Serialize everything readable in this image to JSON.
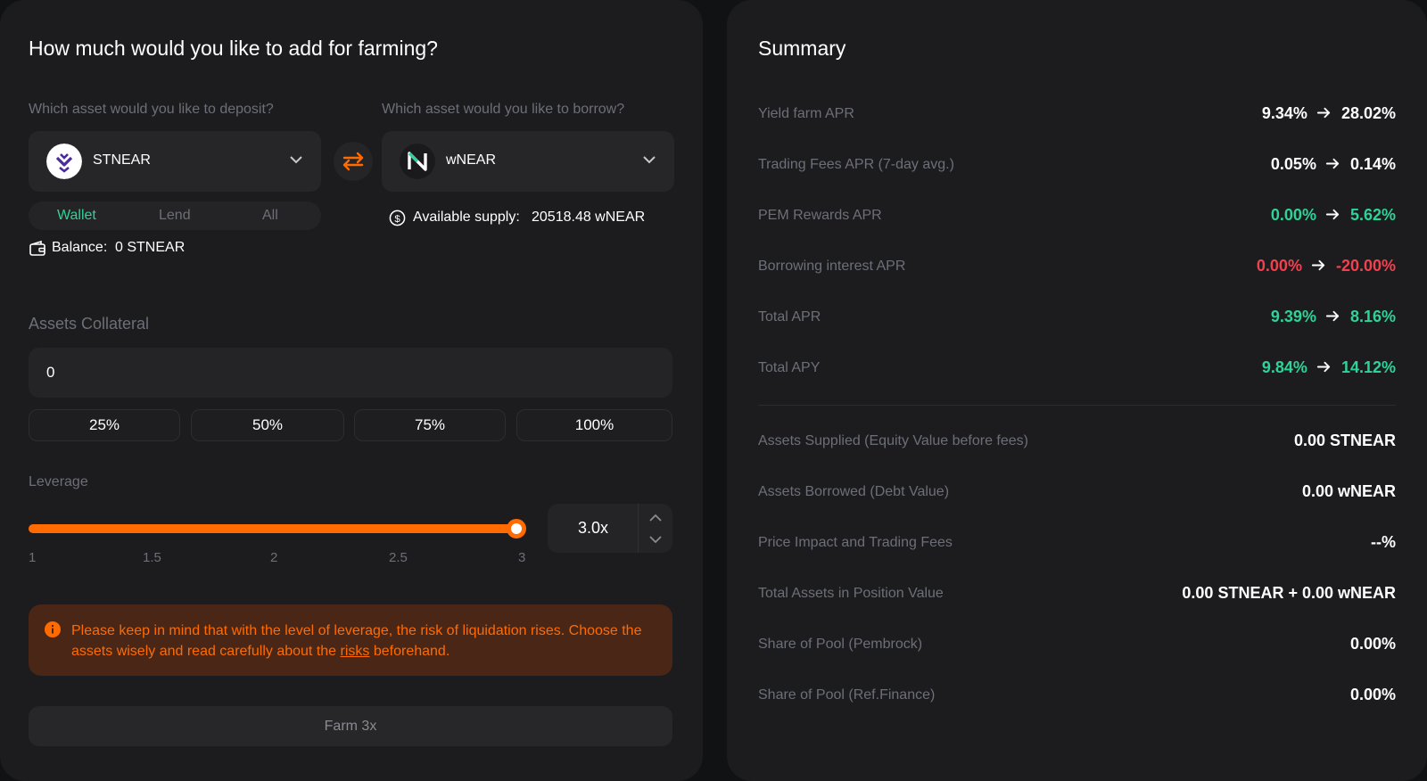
{
  "left": {
    "title": "How much would you like to add for farming?",
    "deposit_label": "Which asset would you like to deposit?",
    "borrow_label": "Which asset would you like to borrow?",
    "deposit_token": {
      "name": "STNEAR",
      "icon": "stnear-logo-icon"
    },
    "borrow_token": {
      "name": "wNEAR",
      "icon": "near-logo-icon"
    },
    "tabs": [
      "Wallet",
      "Lend",
      "All"
    ],
    "active_tab": "Wallet",
    "balance_label": "Balance:",
    "balance_value": "0 STNEAR",
    "supply_label": "Available supply:",
    "supply_value": "20518.48 wNEAR",
    "collateral_label": "Assets Collateral",
    "collateral_value": "0",
    "percent_buttons": [
      "25%",
      "50%",
      "75%",
      "100%"
    ],
    "leverage_label": "Leverage",
    "leverage_ticks": [
      "1",
      "1.5",
      "2",
      "2.5",
      "3"
    ],
    "leverage_value": "3.0x",
    "leverage_level": 3.0,
    "warning_text_1": "Please keep in mind that with the level of leverage, the risk of liquidation rises. Choose the assets wisely and read carefully about the",
    "warning_link": "risks",
    "warning_text_2": "beforehand.",
    "farm_button": "Farm 3x"
  },
  "summary": {
    "title": "Summary",
    "apr_rows": [
      {
        "label": "Yield farm APR",
        "from": "9.34%",
        "to": "28.02%",
        "tone": "white"
      },
      {
        "label": "Trading Fees APR (7-day avg.)",
        "from": "0.05%",
        "to": "0.14%",
        "tone": "white"
      },
      {
        "label": "PEM Rewards APR",
        "from": "0.00%",
        "to": "5.62%",
        "tone": "green"
      },
      {
        "label": "Borrowing interest APR",
        "from": "0.00%",
        "to": "-20.00%",
        "tone": "red"
      },
      {
        "label": "Total APR",
        "from": "9.39%",
        "to": "8.16%",
        "tone": "green"
      },
      {
        "label": "Total APY",
        "from": "9.84%",
        "to": "14.12%",
        "tone": "green"
      }
    ],
    "detail_rows": [
      {
        "label": "Assets Supplied (Equity Value before fees)",
        "value": "0.00 STNEAR"
      },
      {
        "label": "Assets Borrowed (Debt Value)",
        "value": "0.00 wNEAR"
      },
      {
        "label": "Price Impact and Trading Fees",
        "value": "--%"
      },
      {
        "label": "Total Assets in Position Value",
        "value": "0.00 STNEAR + 0.00 wNEAR"
      },
      {
        "label": "Share of Pool (Pembrock)",
        "value": "0.00%"
      },
      {
        "label": "Share of Pool (Ref.Finance)",
        "value": "0.00%"
      }
    ]
  },
  "colors": {
    "accent": "#ff6b00",
    "green": "#2ed397",
    "red": "#f0414f",
    "panel": "#1c1c1f"
  }
}
